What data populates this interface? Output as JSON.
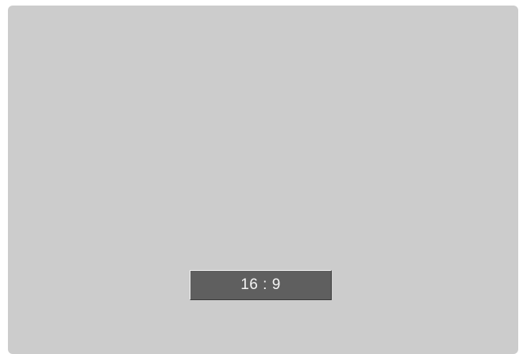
{
  "display": {
    "aspect_ratio_label": "16 : 9"
  },
  "colors": {
    "screen_background": "#cccccc",
    "button_background": "#5f5f5f",
    "button_text": "#f4f4f4"
  }
}
